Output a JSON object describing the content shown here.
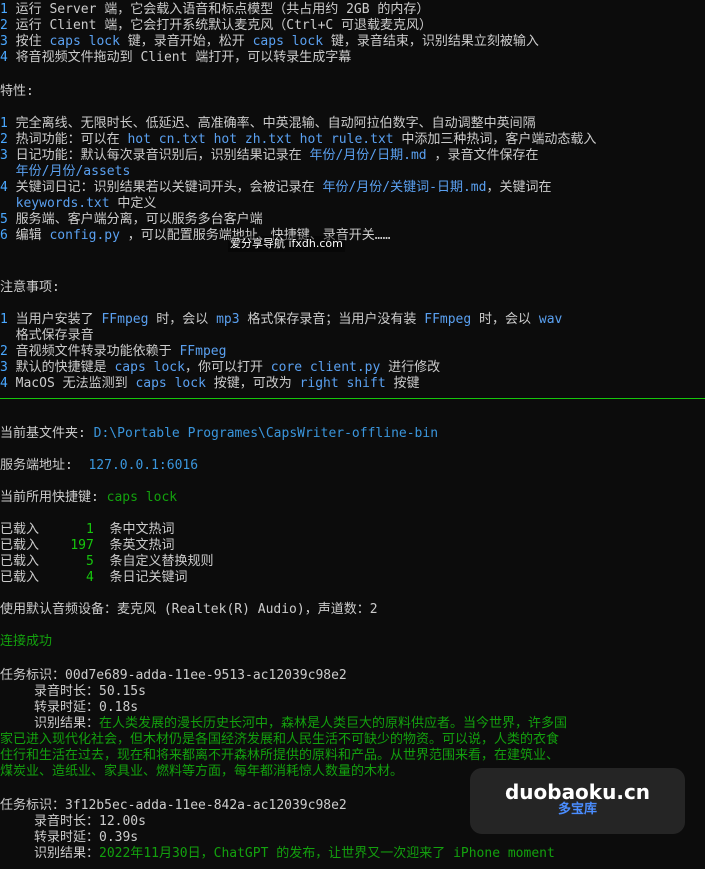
{
  "usage": [
    {
      "n": "1",
      "a": "运行 Server 端，它会载入语音和标点模型（共占用约 2GB 的内存）"
    },
    {
      "n": "2",
      "a": "运行 Client 端，它会打开系统默认麦克风（Ctrl+C 可退载麦克风）"
    },
    {
      "n": "3",
      "a": "按住 ",
      "c": "caps lock",
      "b": " 键，录音开始，松开 ",
      "c2": "caps lock",
      "d": " 键，录音结束，识别结果立刻被输入"
    },
    {
      "n": "4",
      "a": "将音视频文件拖动到 Client 端打开，可以转录生成字幕"
    }
  ],
  "features_title": "特性:",
  "features": [
    {
      "n": "1",
      "a": "完全离线、无限时长、低延迟、高准确率、中英混输、自动阿拉伯数字、自动调整中英间隔"
    },
    {
      "n": "2",
      "a": "热词功能：可以在 ",
      "c": "hot cn.txt hot zh.txt hot rule.txt",
      "b": " 中添加三种热词，客户端动态载入"
    },
    {
      "n": "3",
      "a": "日记功能：默认每次录音识别后，识别结果记录在 ",
      "c": "年份/月份/日期.md",
      "b": " ，录音文件保存在"
    },
    {
      "n": "",
      "a": "  ",
      "c": "年份/月份/assets"
    },
    {
      "n": "4",
      "a": "关键词日记：识别结果若以关键词开头，会被记录在 ",
      "c": "年份/月份/关键词-日期.md",
      "b": "，关键词在"
    },
    {
      "n": "",
      "a": "  ",
      "c": "keywords.txt",
      "b": " 中定义"
    },
    {
      "n": "5",
      "a": "服务端、客户端分离，可以服务多台客户端"
    },
    {
      "n": "6",
      "a": "编辑 ",
      "c": "config.py",
      "b": " ，可以配置服务端地址、快捷键、录音开关……"
    }
  ],
  "notes_title": "注意事项:",
  "notes": [
    {
      "n": "1",
      "a": "当用户安装了 ",
      "c": "FFmpeg",
      "b": " 时，会以 ",
      "c2": "mp3",
      "d": " 格式保存录音；当用户没有装 ",
      "c3": "FFmpeg",
      "e": " 时，会以 ",
      "c4": "wav"
    },
    {
      "n": "",
      "a": "  格式保存录音"
    },
    {
      "n": "2",
      "a": "音视频文件转录功能依赖于 ",
      "c": "FFmpeg"
    },
    {
      "n": "3",
      "a": "默认的快捷键是 ",
      "c": "caps lock",
      "b": "，你可以打开 ",
      "c2": "core client.py",
      "d": " 进行修改"
    },
    {
      "n": "4",
      "a": "MacOS 无法监测到 ",
      "c": "caps lock",
      "b": " 按键，可改为 ",
      "c2": "right shift",
      "d": " 按键"
    }
  ],
  "status": {
    "cwd_label": "当前基文件夹: ",
    "cwd_value": "D:\\Portable Programes\\CapsWriter-offline-bin",
    "server_label": "服务端地址:  ",
    "server_value": "127.0.0.1:6016",
    "hotkey_label": "当前所用快捷键: ",
    "hotkey_value": "caps lock",
    "loaded": [
      {
        "p": "已载入",
        "v": "1",
        "s": "条中文热词"
      },
      {
        "p": "已载入",
        "v": "197",
        "s": "条英文热词"
      },
      {
        "p": "已载入",
        "v": "5",
        "s": "条自定义替换规则"
      },
      {
        "p": "已载入",
        "v": "4",
        "s": "条日记关键词"
      }
    ],
    "audio_device": "使用默认音频设备：麦克风 (Realtek(R) Audio)，声道数：2",
    "connected": "连接成功"
  },
  "tasks": [
    {
      "id_line": "任务标识：00d7e689-adda-11ee-9513-ac12039c98e2",
      "rec": "录音时长：50.15s",
      "delay": "转录时延：0.18s",
      "result_label": "识别结果：",
      "result_lines": [
        "在人类发展的漫长历史长河中，森林是人类巨大的原料供应者。当今世界，许多国",
        "家已进入现代化社会，但木材仍是各国经济发展和人民生活不可缺少的物资。可以说，人类的衣食",
        "住行和生活在过去，现在和将来都离不开森林所提供的原料和产品。从世界范围来看，在建筑业、",
        "煤炭业、造纸业、家具业、燃料等方面，每年都消耗惊人数量的木材。"
      ]
    },
    {
      "id_line": "任务标识：3f12b5ec-adda-11ee-842a-ac12039c98e2",
      "rec": "录音时长：12.00s",
      "delay": "转录时延：0.39s",
      "result_label": "识别结果：",
      "result_lines": [
        "2022年11月30日，ChatGPT 的发布，让世界又一次迎来了 iPhone moment"
      ]
    }
  ],
  "watermarks": {
    "inline": "爱分享导航 ifxdh.com",
    "box_main": "duobaoku.cn",
    "box_sub": "多宝库"
  }
}
